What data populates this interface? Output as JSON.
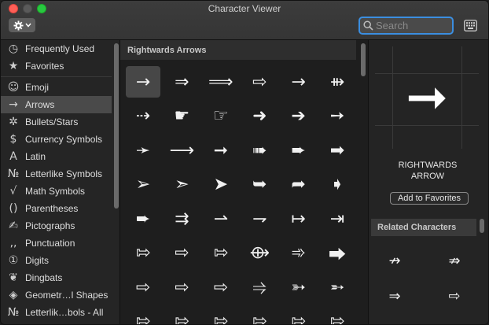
{
  "window": {
    "title": "Character Viewer"
  },
  "toolbar": {
    "search_placeholder": "Search"
  },
  "sidebar": {
    "items": [
      {
        "icon": "◷",
        "icon_name": "clock-icon",
        "label": "Frequently Used"
      },
      {
        "icon": "★",
        "icon_name": "star-icon",
        "label": "Favorites"
      },
      {
        "icon": "☺",
        "icon_name": "smiley-icon",
        "label": "Emoji"
      },
      {
        "icon": "→",
        "icon_name": "arrow-icon",
        "label": "Arrows",
        "selected": true
      },
      {
        "icon": "✲",
        "icon_name": "asterisk-icon",
        "label": "Bullets/Stars"
      },
      {
        "icon": "$",
        "icon_name": "dollar-icon",
        "label": "Currency Symbols"
      },
      {
        "icon": "A",
        "icon_name": "letter-a-icon",
        "label": "Latin"
      },
      {
        "icon": "№",
        "icon_name": "numero-icon",
        "label": "Letterlike Symbols"
      },
      {
        "icon": "√",
        "icon_name": "sqrt-icon",
        "label": "Math Symbols"
      },
      {
        "icon": "()",
        "icon_name": "parentheses-icon",
        "label": "Parentheses"
      },
      {
        "icon": "✍",
        "icon_name": "pictograph-icon",
        "label": "Pictographs"
      },
      {
        "icon": "‚,",
        "icon_name": "punctuation-icon",
        "label": "Punctuation"
      },
      {
        "icon": "①",
        "icon_name": "digit-icon",
        "label": "Digits"
      },
      {
        "icon": "❦",
        "icon_name": "dingbat-icon",
        "label": "Dingbats"
      },
      {
        "icon": "◈",
        "icon_name": "shape-icon",
        "label": "Geometr…l Shapes"
      },
      {
        "icon": "№",
        "icon_name": "letterlike-icon",
        "label": "Letterlik…bols - All"
      }
    ]
  },
  "grid": {
    "header": "Rightwards Arrows",
    "glyphs": [
      "→",
      "⇒",
      "⟹",
      "⇨",
      "→",
      "⇻",
      "⇢",
      "☛",
      "☞",
      "➜",
      "➔",
      "➙",
      "➛",
      "⟶",
      "➞",
      "➠",
      "➨",
      "➡",
      "➢",
      "➣",
      "➤",
      "➥",
      "➦",
      "➧",
      "➨",
      "⇉",
      "⇀",
      "⇁",
      "↦",
      "⇥",
      "⇰",
      "⇨",
      "⇰",
      "⟴",
      "➾",
      "⮕",
      "⇨",
      "⇨",
      "⇨",
      "⥤",
      "➳",
      "➵",
      "⇰",
      "⇰",
      "⇰",
      "⇰",
      "⇰",
      "⇰"
    ]
  },
  "detail": {
    "preview": "➞",
    "name_line1": "RIGHTWARDS",
    "name_line2": "ARROW",
    "favorites_button": "Add to Favorites",
    "related_header": "Related Characters",
    "related": [
      "↛",
      "⇏",
      "⇒",
      "⇨"
    ]
  },
  "colors": {
    "accent": "#3b8ee0",
    "selection": "#4a4a4a"
  }
}
